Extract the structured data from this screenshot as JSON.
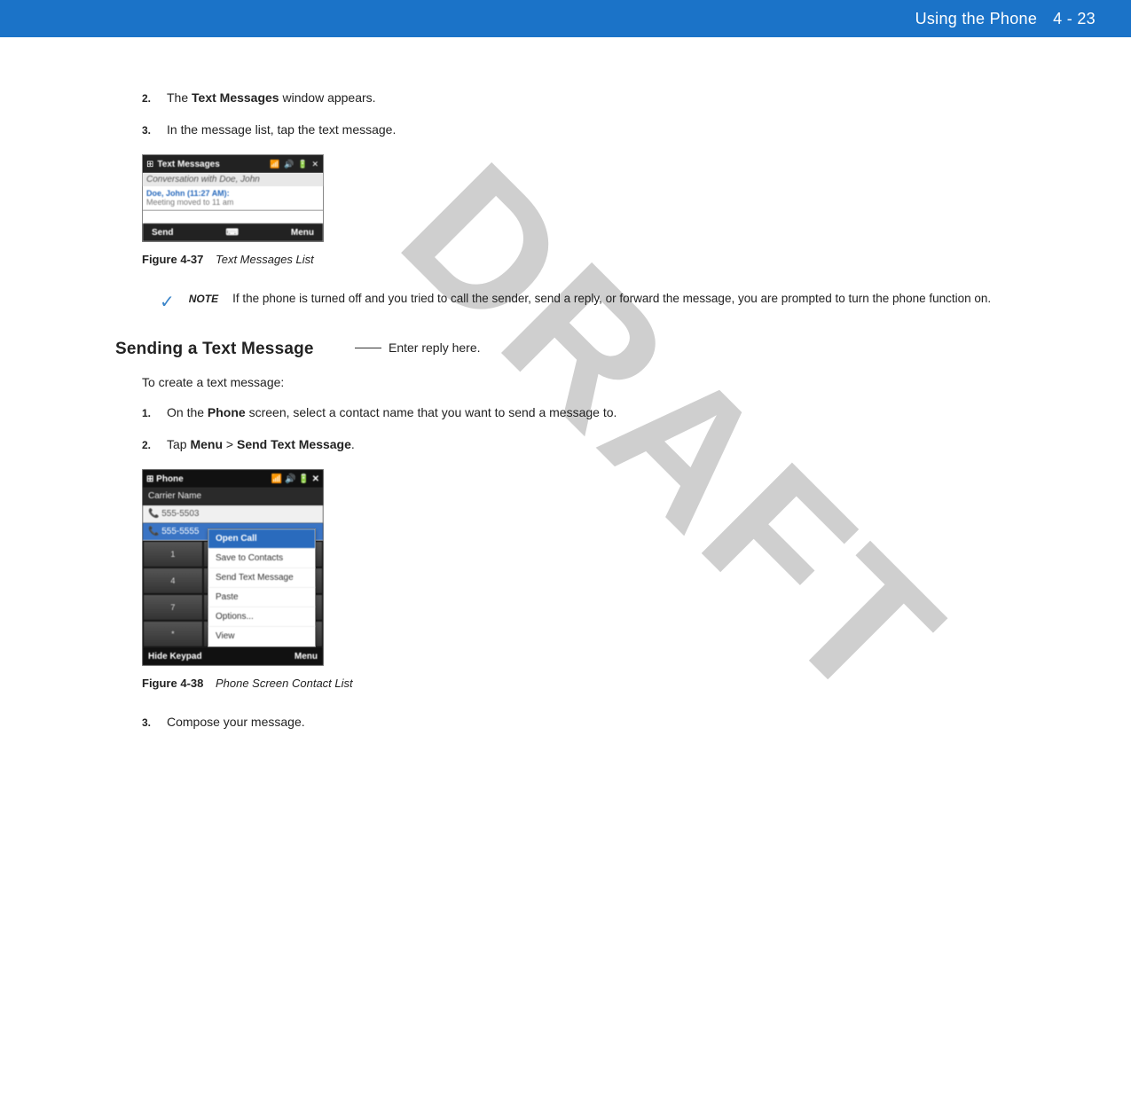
{
  "header": {
    "title": "Using the Phone",
    "pagenum": "4 - 23"
  },
  "watermark": "DRAFT",
  "steps_a": [
    {
      "num": "2.",
      "pre": "The ",
      "bold": "Text Messages",
      "post": " window appears."
    },
    {
      "num": "3.",
      "pre": "In the message list, tap the text message.",
      "bold": "",
      "post": ""
    }
  ],
  "shot1": {
    "title": "Text Messages",
    "conv": "Conversation with Doe, John",
    "sender": "Doe, John (11:27 AM):",
    "msg": "Meeting moved to 11 am",
    "send": "Send",
    "menu": "Menu"
  },
  "annot1": "Enter reply here.",
  "fig1": {
    "num": "Figure 4-37",
    "title": "Text Messages List"
  },
  "note": {
    "label": "NOTE",
    "text": "If the phone is turned off and you tried to call the sender, send a reply, or forward the message, you are prompted to turn the phone function on."
  },
  "section": "Sending a Text Message",
  "intro": "To create a text message:",
  "steps_b": [
    {
      "num": "1.",
      "pre": "On the ",
      "bold": "Phone",
      "post": " screen, select a contact name that you want to send a message to."
    },
    {
      "num": "2.",
      "pre": "Tap ",
      "bold": "Menu",
      "mid": " > ",
      "bold2": "Send Text Message",
      "post": "."
    }
  ],
  "shot2": {
    "title": "Phone",
    "carrier": "Carrier Name",
    "c1": "555-5503",
    "c2": "555-5555",
    "menu_items": [
      "Open Call",
      "Save to Contacts",
      "Send Text Message",
      "Paste",
      "Options...",
      "View"
    ],
    "hide": "Hide Keypad",
    "menu": "Menu"
  },
  "fig2": {
    "num": "Figure 4-38",
    "title": "Phone Screen Contact List"
  },
  "steps_c": [
    {
      "num": "3.",
      "pre": "Compose your message.",
      "bold": "",
      "post": ""
    }
  ]
}
